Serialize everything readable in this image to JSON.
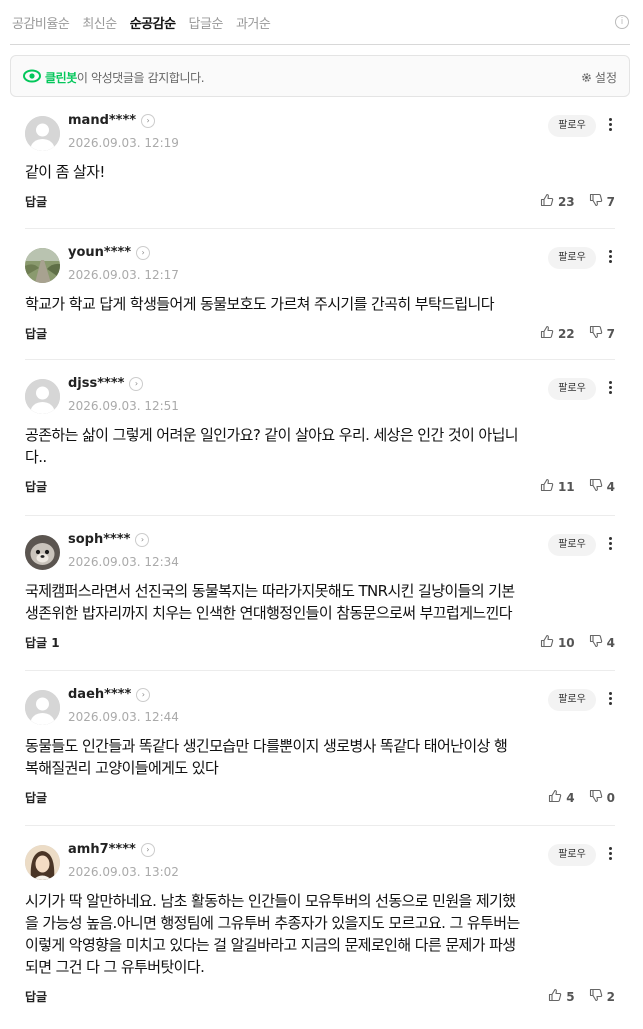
{
  "sort": {
    "tabs": [
      {
        "label": "공감비율순",
        "active": false
      },
      {
        "label": "최신순",
        "active": false
      },
      {
        "label": "순공감순",
        "active": true
      },
      {
        "label": "답글순",
        "active": false
      },
      {
        "label": "과거순",
        "active": false
      }
    ],
    "info_icon": "i"
  },
  "cleanbot": {
    "brand": "클린봇",
    "message": "이 악성댓글을 감지합니다.",
    "settings_label": "설정"
  },
  "colors": {
    "brand_green": "#03c75a",
    "text_muted": "#999999",
    "follow_bg": "#f3f3f3"
  },
  "comments": [
    {
      "user": "mand****",
      "date": "2026.09.03. 12:19",
      "follow": "팔로우",
      "text": "같이 좀 살자!",
      "reply": "답글",
      "likes": "23",
      "dislikes": "7",
      "avatar": "default"
    },
    {
      "user": "youn****",
      "date": "2026.09.03. 12:17",
      "follow": "팔로우",
      "text": "학교가 학교 답게 학생들어게 동물보호도 가르쳐 주시기를 간곡히 부탁드립니다",
      "reply": "답글",
      "likes": "22",
      "dislikes": "7",
      "avatar": "photo-road"
    },
    {
      "user": "djss****",
      "date": "2026.09.03. 12:51",
      "follow": "팔로우",
      "text": "공존하는 삶이 그렇게 어려운 일인가요? 같이 살아요 우리. 세상은 인간 것이 아닙니\n다..",
      "reply": "답글",
      "likes": "11",
      "dislikes": "4",
      "avatar": "default"
    },
    {
      "user": "soph****",
      "date": "2026.09.03. 12:34",
      "follow": "팔로우",
      "text": "국제캠퍼스라면서 선진국의 동물복지는 따라가지못해도 TNR시킨 길냥이들의 기본\n생존위한 밥자리까지 치우는 인색한 연대행정인들이 참동문으로써 부끄럽게느낀다",
      "reply": "답글 1",
      "likes": "10",
      "dislikes": "4",
      "avatar": "photo-dog"
    },
    {
      "user": "daeh****",
      "date": "2026.09.03. 12:44",
      "follow": "팔로우",
      "text": "동물들도 인간들과 똑같다 생긴모습만 다를뿐이지 생로병사 똑같다 태어난이상 행\n복해질권리 고양이들에게도 있다",
      "reply": "답글",
      "likes": "4",
      "dislikes": "0",
      "avatar": "default"
    },
    {
      "user": "amh7****",
      "date": "2026.09.03. 13:02",
      "follow": "팔로우",
      "text": "시기가 딱 알만하네요. 남초 활동하는 인간들이 모유투버의 선동으로 민원을 제기했\n을 가능성 높음.아니면 행정팀에 그유투버 추종자가 있을지도 모르고요. 그 유투버는\n이렇게 악영향을 미치고 있다는 걸 알길바라고 지금의 문제로인해 다른 문제가 파생\n되면 그건 다 그 유투버탓이다.",
      "reply": "답글",
      "likes": "5",
      "dislikes": "2",
      "avatar": "photo-person"
    }
  ]
}
